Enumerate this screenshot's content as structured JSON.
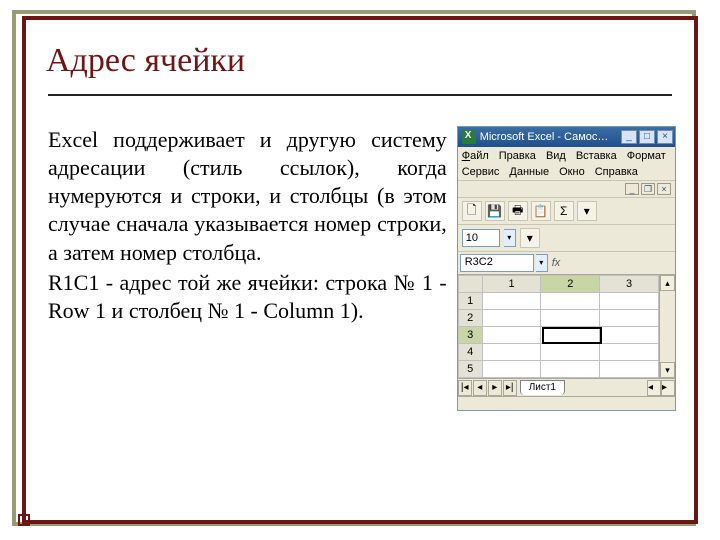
{
  "slide": {
    "title": "Адрес ячейки",
    "para1_lead": "Excel ",
    "para1_rest": "поддерживает и другую систему адресации (стиль ссылок), когда нумеруются и строки, и столбцы (в этом случае сначала указывается номер строки, а затем номер столбца.",
    "para2": "R1C1 - адрес той же ячейки: строка № 1 - Row 1 и столбец № 1 - Column 1)."
  },
  "excel": {
    "title": "Microsoft Excel - Самос…",
    "menu": {
      "file": "Файл",
      "edit": "Правка",
      "view": "Вид",
      "insert": "Вставка",
      "format": "Формат",
      "tools": "Сервис",
      "data": "Данные",
      "window": "Окно",
      "help": "Справка"
    },
    "font_size": "10",
    "name_box": "R3C2",
    "fx_label": "fx",
    "columns": [
      "1",
      "2",
      "3"
    ],
    "rows": [
      "1",
      "2",
      "3",
      "4",
      "5"
    ],
    "selected_row": "3",
    "selected_col": "2",
    "sheet_tab": "Лист1",
    "toolbar_icons": {
      "new": "🗋",
      "save": "💾",
      "print": "🖶",
      "copy": "📋",
      "sigma": "Σ"
    },
    "win_buttons": {
      "min": "_",
      "max": "□",
      "close": "×"
    }
  }
}
